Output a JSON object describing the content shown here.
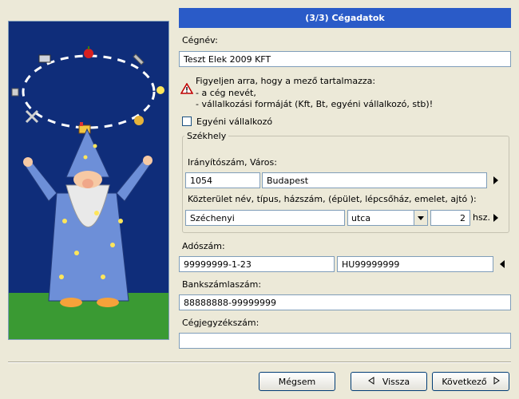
{
  "header": {
    "title": "(3/3) Cégadatok"
  },
  "company_name": {
    "label": "Cégnév:",
    "value": "Teszt Elek 2009 KFT"
  },
  "warning": {
    "line1": "Figyeljen arra, hogy a mező tartalmazza:",
    "line2": "- a cég nevét,",
    "line3": "- vállalkozási formáját (Kft, Bt, egyéni vállalkozó, stb)!"
  },
  "sole_trader": {
    "label": "Egyéni vállalkozó",
    "checked": false
  },
  "address": {
    "group_label": "Székhely",
    "zip_city_label": "Irányítószám, Város:",
    "zip": "1054",
    "city": "Budapest",
    "street_label": "Közterület név, típus, házszám, (épület, lépcsőház, emelet, ajtó ):",
    "street_name": "Széchenyi",
    "street_type": "utca",
    "house_number": "2",
    "house_number_suffix": "hsz."
  },
  "tax": {
    "label": "Adószám:",
    "value1": "99999999-1-23",
    "value2": "HU99999999"
  },
  "bank": {
    "label": "Bankszámlaszám:",
    "value": "88888888-99999999"
  },
  "registry": {
    "label": "Cégjegyzékszám:",
    "value": ""
  },
  "buttons": {
    "cancel": "Mégsem",
    "back": "Vissza",
    "next": "Következő"
  },
  "colors": {
    "header_bg": "#2a5bc8",
    "panel_bg": "#0f2d7a",
    "grass": "#3a9a33",
    "robe": "#6d8fd8"
  },
  "icons": [
    "keyboard-icon",
    "apple-icon",
    "wrench-icon",
    "lock-icon",
    "lightbulb-icon",
    "tools-icon",
    "moneybag-icon",
    "books-icon"
  ]
}
